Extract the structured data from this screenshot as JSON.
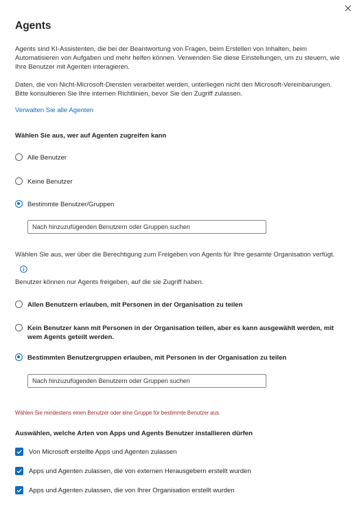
{
  "dialog": {
    "title": "Agents",
    "intro": "Agents sind KI-Assistenten, die bei der Beantwortung von Fragen, beim Erstellen von Inhalten, beim Automatisieren von Aufgaben und mehr helfen können. Verwenden Sie diese Einstellungen, um zu steuern, wie Ihre Benutzer mit Agenten interagieren.",
    "disclaimer": "Daten, die von Nicht-Microsoft-Diensten verarbeitet werden, unterliegen nicht den Microsoft-Vereinbarungen. Bitte konsultieren Sie Ihre internen Richtlinien, bevor Sie den Zugriff zulassen.",
    "manage_link": "Verwalten Sie alle Agenten"
  },
  "access": {
    "heading": "Wählen Sie aus, wer auf Agenten zugreifen kann",
    "options": [
      {
        "label": "Alle Benutzer",
        "checked": false
      },
      {
        "label": "Keine Benutzer",
        "checked": false
      },
      {
        "label": "Bestimmte Benutzer/Gruppen",
        "checked": true
      }
    ],
    "search_placeholder": "Nach hinzuzufügenden Benutzern oder Gruppen suchen"
  },
  "sharing": {
    "heading": "Wählen Sie aus, wer über die Berechtigung zum Freigeben von Agents für Ihre gesamte Organisation verfügt.",
    "info_icon": "info-icon",
    "note": "Benutzer können nur Agents freigeben, auf die sie Zugriff haben.",
    "options": [
      {
        "label": "Allen Benutzern erlauben, mit Personen in der Organisation zu teilen",
        "checked": false
      },
      {
        "label": "Kein Benutzer kann mit Personen in der Organisation teilen, aber es kann ausgewählt werden, mit wem Agents geteilt werden.",
        "checked": false
      },
      {
        "label": "Bestimmten Benutzergruppen erlauben, mit Personen in der Organisation zu teilen",
        "checked": true
      }
    ],
    "search_placeholder": "Nach hinzuzufügenden Benutzern oder Gruppen suchen",
    "error": "Wählen Sie mindestens einen Benutzer oder eine Gruppe für bestimmte Benutzer aus."
  },
  "install": {
    "heading": "Auswählen, welche Arten von Apps und Agents Benutzer installieren dürfen",
    "options": [
      {
        "label": "Von Microsoft erstellte Apps und Agenten zulassen",
        "checked": true
      },
      {
        "label": "Apps und Agenten zulassen, die von externen Herausgebern erstellt wurden",
        "checked": true
      },
      {
        "label": "Apps und Agenten zulassen, die von Ihrer Organisation erstellt wurden",
        "checked": true
      }
    ]
  },
  "colors": {
    "accent": "#0f6cbd",
    "error": "#a4262c",
    "text": "#242424"
  }
}
